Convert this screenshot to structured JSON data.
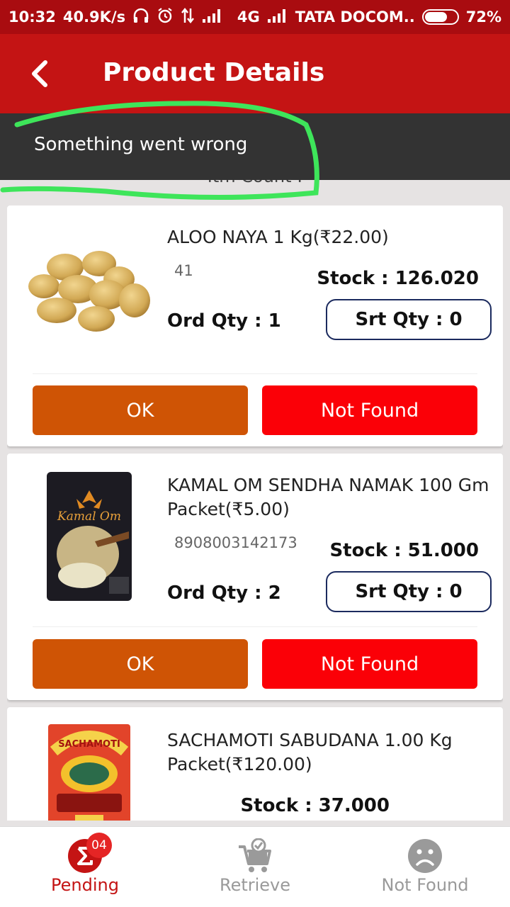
{
  "status_bar": {
    "time": "10:32",
    "speed": "40.9K/s",
    "network": "4G",
    "carrier": "TATA DOCOM..",
    "battery": "72%",
    "battery_level": 0.72,
    "icons": [
      "headphones-icon",
      "alarm-icon",
      "data-arrows-icon",
      "signal-icon",
      "battery-icon"
    ]
  },
  "app_bar": {
    "back_icon": "chevron-left-icon",
    "title": "Product Details"
  },
  "item_count_label": "Itm Count :",
  "toast": {
    "message": "Something went wrong",
    "annotation_color": "#3ee55a"
  },
  "products": [
    {
      "name": "ALOO NAYA 1 Kg(₹22.00)",
      "code": "41",
      "stock": "Stock : 126.020",
      "ord_qty": "Ord Qty : 1",
      "srt_qty": "Srt Qty : 0",
      "ok_label": "OK",
      "not_found_label": "Not Found",
      "image": "potatoes"
    },
    {
      "name": "KAMAL OM SENDHA NAMAK 100 Gm Packet(₹5.00)",
      "code": "8908003142173",
      "stock": "Stock : 51.000",
      "ord_qty": "Ord Qty : 2",
      "srt_qty": "Srt Qty : 0",
      "ok_label": "OK",
      "not_found_label": "Not Found",
      "image": "salt-packet",
      "image_text": "Kamal Om"
    },
    {
      "name": "SACHAMOTI SABUDANA 1.00 Kg Packet(₹120.00)",
      "stock": "Stock : 37.000",
      "image": "sabudana-packet",
      "image_text": "SACHAMOTI"
    }
  ],
  "bottom_nav": [
    {
      "label": "Pending",
      "icon": "sigma-icon",
      "badge": "04",
      "active": true
    },
    {
      "label": "Retrieve",
      "icon": "cart-check-icon",
      "active": false
    },
    {
      "label": "Not Found",
      "icon": "sad-face-icon",
      "active": false
    }
  ],
  "colors": {
    "status_bar": "#a90c10",
    "app_bar": "#c41414",
    "ok_button": "#cf5405",
    "not_found_button": "#fb0007",
    "toast": "#333333",
    "active_tab": "#c41414",
    "inactive_tab": "#9a9a9a"
  }
}
